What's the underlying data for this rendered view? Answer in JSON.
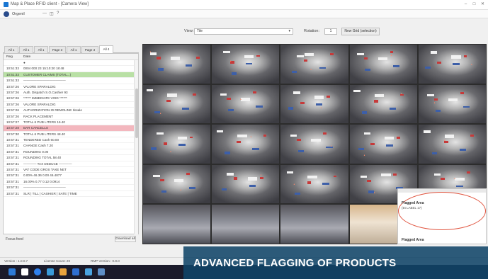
{
  "window": {
    "title": "Map & Place RFID client - [Camera View]",
    "controls": [
      "–",
      "□",
      "✕"
    ]
  },
  "menubar": {
    "user": "Orgenil",
    "items": [
      "—",
      "◫",
      "?"
    ]
  },
  "viewbar": {
    "view_label": "View:",
    "view_value": "Tile",
    "rotation_label": "Rotation:",
    "rotation_value": "1",
    "new_button": "New Grid (selection)"
  },
  "tabs": [
    "All 1",
    "All 1",
    "All 1",
    "Page 3",
    "All 1",
    "Page 3",
    "All 4"
  ],
  "journal": {
    "columns": [
      "Reg",
      "Date"
    ],
    "rows": [
      {
        "t": "",
        "v": "●",
        "hl": ""
      },
      {
        "t": "10:51:33",
        "v": "0004    000    23  15:10:20   18:48",
        "hl": ""
      },
      {
        "t": "10:51:33",
        "v": "CUSTOMER CLAIMS (TOTAL...)",
        "hl": "green"
      },
      {
        "t": "10:51:33",
        "v": "—————————————",
        "hl": ""
      },
      {
        "t": "10:57:26",
        "v": "VALORE SPARALDIG",
        "hl": ""
      },
      {
        "t": "10:57:26",
        "v": "Auth. Dispatch   S.O.Cashier 93",
        "hl": ""
      },
      {
        "t": "10:57:26",
        "v": "****** IMMEDIATE VOID ******",
        "hl": ""
      },
      {
        "t": "10:57:26",
        "v": "VALORE SPARALDIG",
        "hl": ""
      },
      {
        "t": "10:57:26",
        "v": "AUTHORIZATION ID    REMOLINE Ilosale",
        "hl": ""
      },
      {
        "t": "10:57:26",
        "v": "RACK PLACEMENT",
        "hl": ""
      },
      {
        "t": "10:57:27",
        "v": "TOTAL    6    PUB  LITERS        16.40",
        "hl": ""
      },
      {
        "t": "10:57:28",
        "v": "BAR CANCELLS",
        "hl": "red"
      },
      {
        "t": "10:57:30",
        "v": "TOTAL    6    PUB  LITERS        48.40",
        "hl": ""
      },
      {
        "t": "10:57:31",
        "v": "TENDERED Cash              60.00",
        "hl": ""
      },
      {
        "t": "10:57:31",
        "v": "CHANGE   Cash               7.20",
        "hl": ""
      },
      {
        "t": "10:57:31",
        "v": "ROUNDING                    0.00",
        "hl": ""
      },
      {
        "t": "10:57:31",
        "v": "ROUNDING TOTAL            58.40",
        "hl": ""
      },
      {
        "t": "10:57:31",
        "v": "———— TAX DEDUCE ————",
        "hl": ""
      },
      {
        "t": "10:57:31",
        "v": "VAT CODE    GROS    TAXE     NET",
        "hl": ""
      },
      {
        "t": "10:57:31",
        "v": "0.00%      46.36    0.00     46.4877",
        "hl": ""
      },
      {
        "t": "10:57:31",
        "v": "16.00%     0.77     0.12     0.0914",
        "hl": ""
      },
      {
        "t": "10:57:31",
        "v": "—————————————",
        "hl": ""
      },
      {
        "t": "10:57:31",
        "v": "SLR  |  TILL  |  CASHIER  |  SATE  |  TIME",
        "hl": ""
      }
    ],
    "focus_label": "Focus feed",
    "download_label": "Download all"
  },
  "flag_panel": {
    "title": "Flagged Area",
    "subtitle": "(Et LABEL 17)",
    "footer_title": "Flagged Area"
  },
  "statusbar": {
    "version": "Version : 1.0.0.7",
    "license": "License Count: 20",
    "rmp": "RMP Version : 0.8.0"
  },
  "banner": {
    "text": "ADVANCED FLAGGING OF PRODUCTS"
  },
  "colors": {
    "banner_bg": "#104468",
    "highlight_green": "#b9e0a5",
    "highlight_red": "#f3b7be",
    "flag_ring": "#e0543f",
    "taskbar": "#1b1b2b"
  }
}
